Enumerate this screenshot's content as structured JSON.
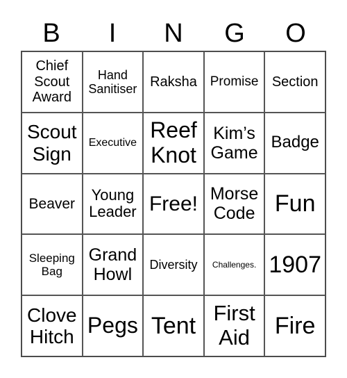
{
  "header": [
    "B",
    "I",
    "N",
    "G",
    "O"
  ],
  "cells": [
    "Chief\nScout\nAward",
    "Hand\nSanitiser",
    "Raksha",
    "Promise",
    "Section",
    "Scout\nSign",
    "Executive",
    "Reef\nKnot",
    "Kim’s\nGame",
    "Badge",
    "Beaver",
    "Young\nLeader",
    "Free!",
    "Morse\nCode",
    "Fun",
    "Sleeping\nBag",
    "Grand\nHowl",
    "Diversity",
    "Challenges.",
    "1907",
    "Clove\nHitch",
    "Pegs",
    "Tent",
    "First\nAid",
    "Fire"
  ]
}
